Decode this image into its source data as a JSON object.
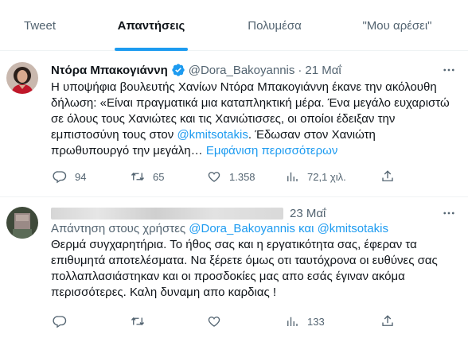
{
  "tabs": [
    {
      "label": "Tweet",
      "active": false
    },
    {
      "label": "Απαντήσεις",
      "active": true
    },
    {
      "label": "Πολυμέσα",
      "active": false
    },
    {
      "label": "\"Μου αρέσει\"",
      "active": false
    }
  ],
  "accent_color": "#1d9bf0",
  "tweet1": {
    "display_name": "Ντόρα Μπακογιάννη",
    "verified_icon": "verified-badge-icon",
    "handle": "@Dora_Bakoyannis",
    "dot": "·",
    "date": "21 Μαΐ",
    "text_part1": "Η υποψήφια βουλευτής Χανίων Ντόρα Μπακογιάννη έκανε την ακόλουθη δήλωση: «Είναι πραγματικά μια καταπληκτική μέρα. Ένα μεγάλο ευχαριστώ σε όλους τους Χανιώτες και τις Χανιώτισσες, οι οποίοι έδειξαν την εμπιστοσύνη τους στον ",
    "mention": "@kmitsotakis",
    "text_part2": ". Έδωσαν στον Χανιώτη πρωθυπουργό την μεγάλη… ",
    "show_more": "Εμφάνιση περισσότερων",
    "replies": "94",
    "retweets": "65",
    "likes": "1.358",
    "views": "72,1 χιλ."
  },
  "tweet2": {
    "date": "23 Μαΐ",
    "reply_to_prefix": "Απάντηση στους χρήστες ",
    "reply_to_user1": "@Dora_Bakoyannis",
    "reply_to_and": " και ",
    "reply_to_user2": "@kmitsotakis",
    "text": "Θερμά συγχαρητήρια. Το ήθος σας και η εργατικότητα σας, έφεραν τα επιθυμητά αποτελέσματα. Να ξέρετε όμως οτι ταυτόχρονα οι ευθύνες σας πολλαπλασιάστηκαν και οι προσδοκίες μας απο εσάς έγιναν ακόμα περισσότερες. Καλη δυναμη απο καρδιας !",
    "views": "133"
  }
}
